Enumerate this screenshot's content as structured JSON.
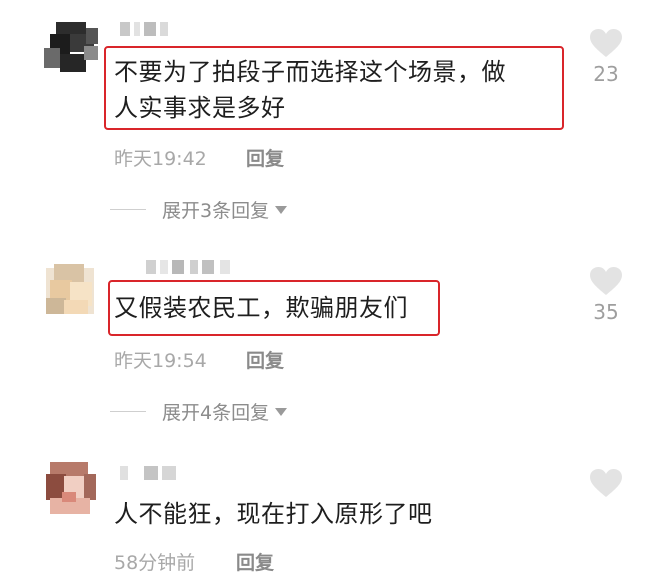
{
  "comments": [
    {
      "text_line1": "不要为了拍段子而选择这个场景，做",
      "text_line2": "人实事求是多好",
      "time": "昨天19:42",
      "reply_label": "回复",
      "expand_label": "展开3条回复",
      "likes": "23",
      "highlighted": true
    },
    {
      "text_line1": "又假装农民工，欺骗朋友们",
      "time": "昨天19:54",
      "reply_label": "回复",
      "expand_label": "展开4条回复",
      "likes": "35",
      "highlighted": true
    },
    {
      "text_line1": "人不能狂，现在打入原形了吧",
      "time": "58分钟前",
      "reply_label": "回复",
      "highlighted": false
    }
  ],
  "colors": {
    "highlight_border": "#d9252a",
    "meta_text": "#a8a8a8",
    "heart_fill": "#e3e3e3"
  },
  "icons": {
    "like": "heart-icon",
    "expand_caret": "caret-down-icon"
  }
}
